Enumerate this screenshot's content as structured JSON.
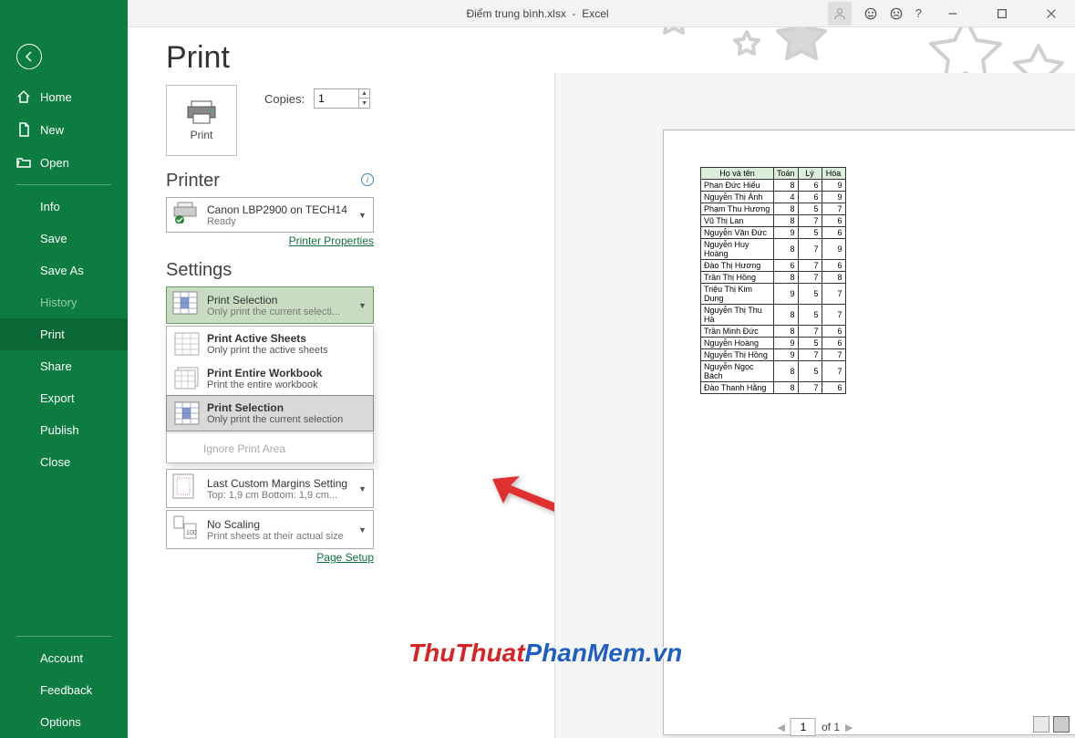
{
  "titlebar": {
    "filename": "Điểm trung bình.xlsx",
    "app": "Excel"
  },
  "sidebar": {
    "home": "Home",
    "new": "New",
    "open": "Open",
    "items": [
      "Info",
      "Save",
      "Save As",
      "History",
      "Print",
      "Share",
      "Export",
      "Publish",
      "Close"
    ],
    "bottom": [
      "Account",
      "Feedback",
      "Options"
    ]
  },
  "page": {
    "title": "Print",
    "print_btn": "Print",
    "copies_label": "Copies:",
    "copies_value": "1",
    "printer_h": "Printer",
    "printer": {
      "name": "Canon LBP2900 on TECH14",
      "status": "Ready"
    },
    "printer_props": "Printer Properties",
    "settings_h": "Settings",
    "what": {
      "t": "Print Selection",
      "d": "Only print the current selecti..."
    },
    "dd": [
      {
        "t": "Print Active Sheets",
        "d": "Only print the active sheets"
      },
      {
        "t": "Print Entire Workbook",
        "d": "Print the entire workbook"
      },
      {
        "t": "Print Selection",
        "d": "Only print the current selection"
      }
    ],
    "ignore": "Ignore Print Area",
    "margins": {
      "t": "Last Custom Margins Setting",
      "d": "Top: 1,9 cm Bottom: 1,9 cm..."
    },
    "scaling": {
      "t": "No Scaling",
      "d": "Print sheets at their actual size"
    },
    "page_setup": "Page Setup"
  },
  "pager": {
    "page": "1",
    "of": "of 1"
  },
  "watermark": {
    "a": "ThuThuat",
    "b": "PhanMem",
    "c": ".vn"
  },
  "chart_data": {
    "type": "table",
    "headers": [
      "Họ và tên",
      "Toán",
      "Lý",
      "Hóa"
    ],
    "rows": [
      [
        "Phan Đức Hiếu",
        "8",
        "6",
        "9"
      ],
      [
        "Nguyễn Thị Ánh",
        "4",
        "6",
        "9"
      ],
      [
        "Phạm Thu Hương",
        "8",
        "5",
        "7"
      ],
      [
        "Vũ Thị Lan",
        "8",
        "7",
        "6"
      ],
      [
        "Nguyễn Văn Đức",
        "9",
        "5",
        "6"
      ],
      [
        "Nguyễn Huy Hoàng",
        "8",
        "7",
        "9"
      ],
      [
        "Đào Thị Hương",
        "6",
        "7",
        "6"
      ],
      [
        "Trần Thị Hồng",
        "8",
        "7",
        "8"
      ],
      [
        "Triệu Thị Kim Dung",
        "9",
        "5",
        "7"
      ],
      [
        "Nguyễn Thị Thu Hà",
        "8",
        "5",
        "7"
      ],
      [
        "Trần Minh Đức",
        "8",
        "7",
        "6"
      ],
      [
        "Nguyễn Hoàng",
        "9",
        "5",
        "6"
      ],
      [
        "Nguyễn Thị Hồng",
        "9",
        "7",
        "7"
      ],
      [
        "Nguyễn Ngọc Bách",
        "8",
        "5",
        "7"
      ],
      [
        "Đào Thanh Hằng",
        "8",
        "7",
        "6"
      ]
    ]
  }
}
